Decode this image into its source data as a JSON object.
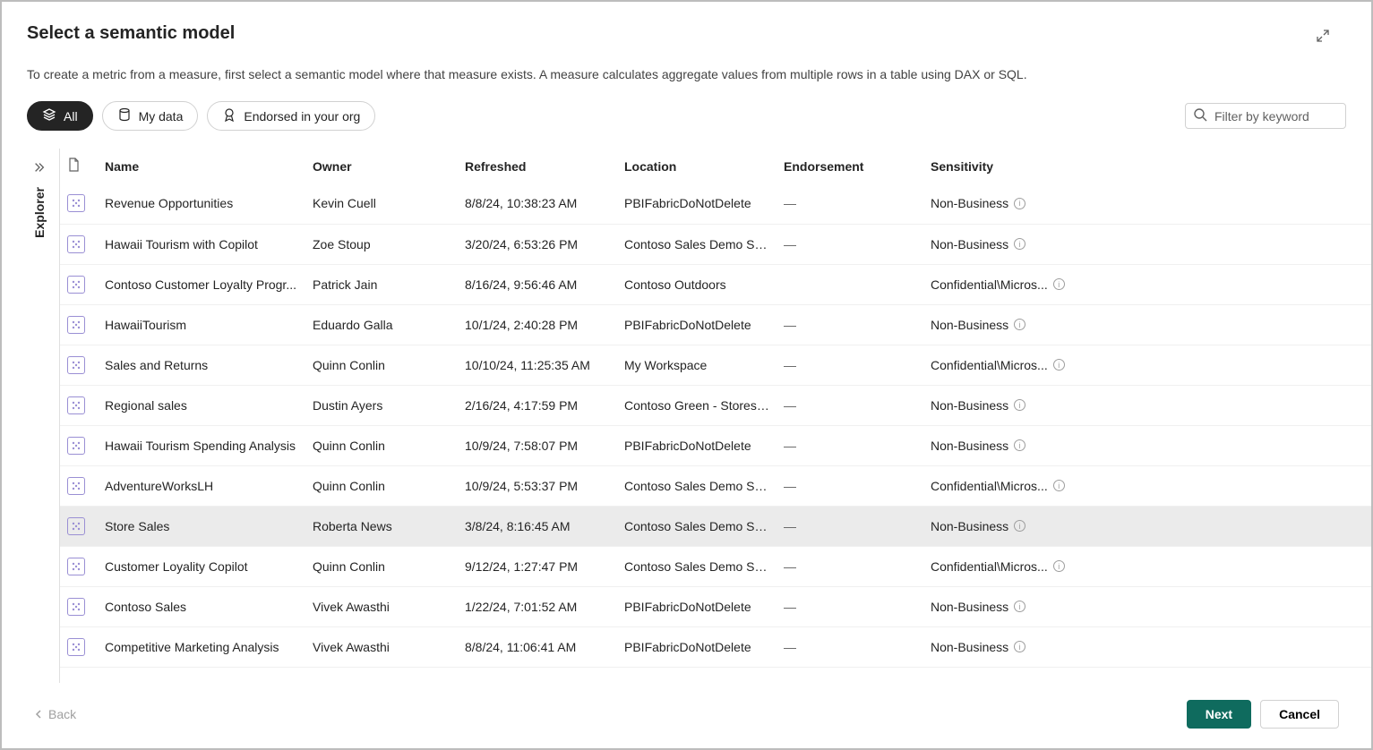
{
  "dialog": {
    "title": "Select a semantic model",
    "description": "To create a metric from a measure, first select a semantic model where that measure exists. A measure calculates aggregate values from multiple rows in a table using DAX or SQL."
  },
  "filters": {
    "all": "All",
    "mydata": "My data",
    "endorsed": "Endorsed in your org"
  },
  "search": {
    "placeholder": "Filter by keyword"
  },
  "explorer": {
    "label": "Explorer"
  },
  "columns": {
    "name": "Name",
    "owner": "Owner",
    "refreshed": "Refreshed",
    "location": "Location",
    "endorsement": "Endorsement",
    "sensitivity": "Sensitivity"
  },
  "rows": [
    {
      "name": "Revenue Opportunities",
      "owner": "Kevin Cuell",
      "refreshed": "8/8/24, 10:38:23 AM",
      "location": "PBIFabricDoNotDelete",
      "endorsement": "—",
      "sensitivity": "Non-Business",
      "selected": false
    },
    {
      "name": "Hawaii Tourism with Copilot",
      "owner": "Zoe Stoup",
      "refreshed": "3/20/24, 6:53:26 PM",
      "location": "Contoso Sales Demo Sp...",
      "endorsement": "—",
      "sensitivity": "Non-Business",
      "selected": false
    },
    {
      "name": "Contoso Customer Loyalty Progr...",
      "owner": "Patrick Jain",
      "refreshed": "8/16/24, 9:56:46 AM",
      "location": "Contoso Outdoors",
      "endorsement": "",
      "sensitivity": "Confidential\\Micros...",
      "selected": false
    },
    {
      "name": "HawaiiTourism",
      "owner": "Eduardo Galla",
      "refreshed": "10/1/24, 2:40:28 PM",
      "location": "PBIFabricDoNotDelete",
      "endorsement": "—",
      "sensitivity": "Non-Business",
      "selected": false
    },
    {
      "name": "Sales and Returns",
      "owner": "Quinn Conlin",
      "refreshed": "10/10/24, 11:25:35 AM",
      "location": "My Workspace",
      "endorsement": "—",
      "sensitivity": "Confidential\\Micros...",
      "selected": false
    },
    {
      "name": "Regional sales",
      "owner": "Dustin Ayers",
      "refreshed": "2/16/24, 4:17:59 PM",
      "location": "Contoso Green - Stores ...",
      "endorsement": "—",
      "sensitivity": "Non-Business",
      "selected": false
    },
    {
      "name": "Hawaii Tourism Spending Analysis",
      "owner": "Quinn Conlin",
      "refreshed": "10/9/24, 7:58:07 PM",
      "location": "PBIFabricDoNotDelete",
      "endorsement": "—",
      "sensitivity": "Non-Business",
      "selected": false
    },
    {
      "name": "AdventureWorksLH",
      "owner": "Quinn Conlin",
      "refreshed": "10/9/24, 5:53:37 PM",
      "location": "Contoso Sales Demo Sp...",
      "endorsement": "—",
      "sensitivity": "Confidential\\Micros...",
      "selected": false
    },
    {
      "name": "Store Sales",
      "owner": "Roberta News",
      "refreshed": "3/8/24, 8:16:45 AM",
      "location": "Contoso Sales Demo Sp...",
      "endorsement": "—",
      "sensitivity": "Non-Business",
      "selected": true
    },
    {
      "name": "Customer Loyality Copilot",
      "owner": "Quinn Conlin",
      "refreshed": "9/12/24, 1:27:47 PM",
      "location": "Contoso Sales Demo Sp...",
      "endorsement": "—",
      "sensitivity": "Confidential\\Micros...",
      "selected": false
    },
    {
      "name": "Contoso Sales",
      "owner": "Vivek Awasthi",
      "refreshed": "1/22/24, 7:01:52 AM",
      "location": "PBIFabricDoNotDelete",
      "endorsement": "—",
      "sensitivity": "Non-Business",
      "selected": false
    },
    {
      "name": "Competitive Marketing Analysis",
      "owner": "Vivek Awasthi",
      "refreshed": "8/8/24, 11:06:41 AM",
      "location": "PBIFabricDoNotDelete",
      "endorsement": "—",
      "sensitivity": "Non-Business",
      "selected": false
    }
  ],
  "footer": {
    "back": "Back",
    "next": "Next",
    "cancel": "Cancel"
  }
}
